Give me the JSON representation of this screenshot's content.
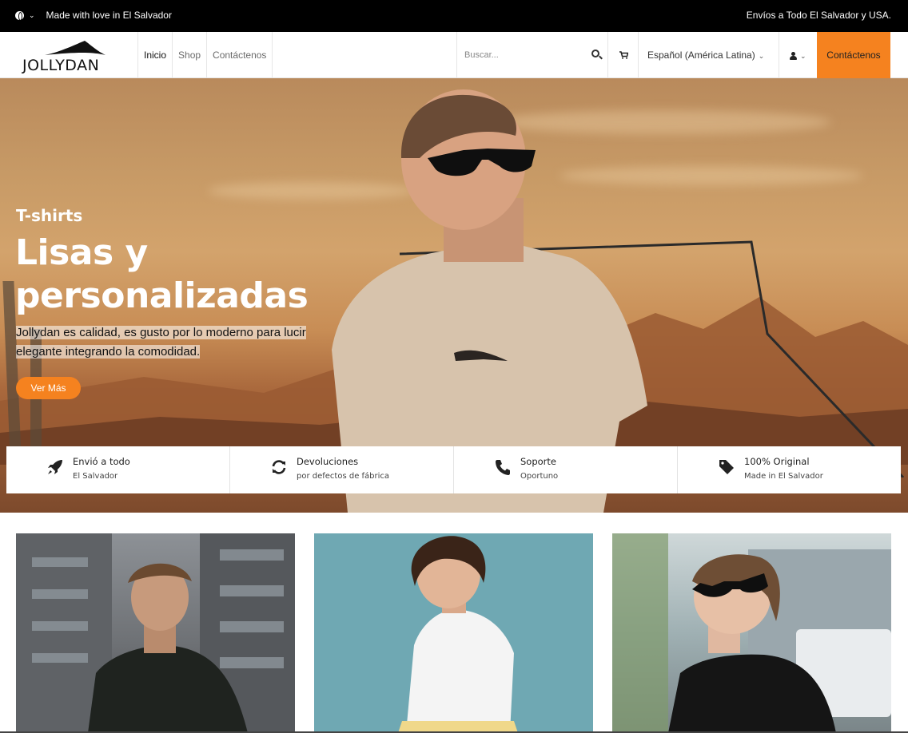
{
  "topbar": {
    "made_with_love": "Made with love in El Salvador",
    "shipping": "Envíos a Todo El Salvador y USA."
  },
  "brand": {
    "name": "JOLLYDAN"
  },
  "nav": {
    "links": [
      "Inicio",
      "Shop",
      "Contáctenos"
    ],
    "search_placeholder": "Buscar...",
    "language": "Español (América Latina)",
    "cta": "Contáctenos"
  },
  "hero": {
    "eyebrow": "T-shirts",
    "title_line1": "Lisas y",
    "title_line2": "personalizadas",
    "description_line1": "Jollydan es calidad, es gusto por lo moderno para lucir",
    "description_line2": "elegante integrando la comodidad.",
    "button": "Ver Más"
  },
  "features": [
    {
      "icon": "rocket-icon",
      "title": "Envió a todo",
      "subtitle": "El Salvador"
    },
    {
      "icon": "refresh-icon",
      "title": "Devoluciones",
      "subtitle": "por defectos de fábrica"
    },
    {
      "icon": "phone-icon",
      "title": "Soporte",
      "subtitle": "Oportuno"
    },
    {
      "icon": "tag-icon",
      "title": "100% Original",
      "subtitle": "Made in El Salvador"
    }
  ],
  "colors": {
    "accent": "#f5821f",
    "topbar": "#000000"
  }
}
